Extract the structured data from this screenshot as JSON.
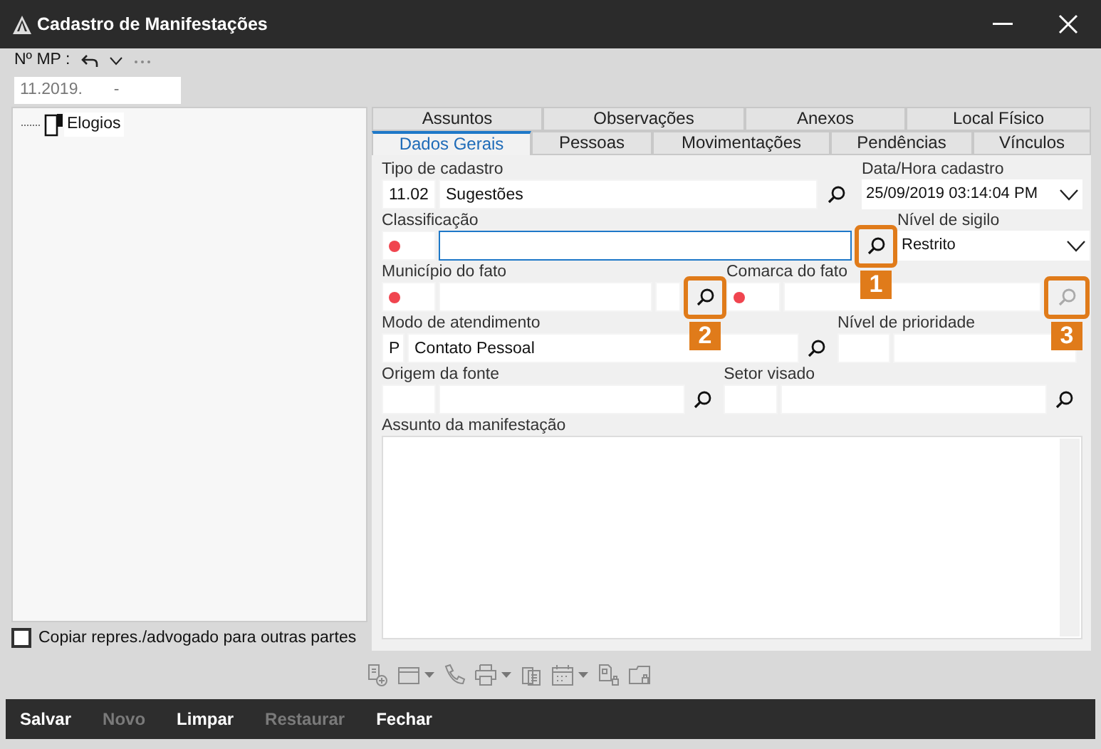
{
  "window": {
    "title": "Cadastro de Manifestações"
  },
  "header": {
    "label": "Nº MP :",
    "value_parts": [
      "11.2019.",
      "-"
    ]
  },
  "tree": [
    {
      "label": "Elogios"
    }
  ],
  "tabs": [
    [
      {
        "label": "Assuntos",
        "selected": false
      },
      {
        "label": "Observações",
        "selected": false
      },
      {
        "label": "Anexos",
        "selected": false
      },
      {
        "label": "Local Físico",
        "selected": false
      }
    ],
    [
      {
        "label": "Dados Gerais",
        "selected": true
      },
      {
        "label": "Pessoas",
        "selected": false
      },
      {
        "label": "Movimentações",
        "selected": false
      },
      {
        "label": "Pendências",
        "selected": false
      },
      {
        "label": "Vínculos",
        "selected": false
      }
    ]
  ],
  "form": [
    {
      "label": "Tipo de cadastro",
      "parts": [
        {
          "kind": "text",
          "value": "11.02"
        },
        {
          "kind": "text",
          "value": "Sugestões"
        },
        {
          "kind": "search",
          "disabled": false
        }
      ]
    },
    {
      "label": "Data/Hora cadastro",
      "parts": [
        {
          "kind": "select",
          "value": "25/09/2019 03:14:04 PM"
        }
      ]
    },
    {
      "label": "Classificação",
      "parts": [
        {
          "kind": "required"
        },
        {
          "kind": "text",
          "focused": true
        },
        {
          "kind": "search",
          "disabled": false,
          "callout": "1"
        }
      ]
    },
    {
      "label": "Nível de sigilo",
      "parts": [
        {
          "kind": "select",
          "value": "Restrito"
        }
      ]
    },
    {
      "label": "Município do fato",
      "parts": [
        {
          "kind": "required"
        },
        {
          "kind": "text"
        },
        {
          "kind": "text"
        },
        {
          "kind": "search",
          "disabled": false,
          "callout": "2"
        }
      ]
    },
    {
      "label": "Comarca do fato",
      "parts": [
        {
          "kind": "required"
        },
        {
          "kind": "text"
        },
        {
          "kind": "search",
          "disabled": true,
          "callout": "3"
        }
      ]
    },
    {
      "label": "Modo de atendimento",
      "parts": [
        {
          "kind": "text",
          "value": "P"
        },
        {
          "kind": "text",
          "value": "Contato Pessoal"
        },
        {
          "kind": "search",
          "disabled": false
        }
      ]
    },
    {
      "label": "Nível de prioridade",
      "parts": [
        {
          "kind": "text"
        },
        {
          "kind": "text"
        }
      ]
    },
    {
      "label": "Origem da fonte",
      "parts": [
        {
          "kind": "text"
        },
        {
          "kind": "text"
        },
        {
          "kind": "search",
          "disabled": false
        }
      ]
    },
    {
      "label": "Setor visado",
      "parts": [
        {
          "kind": "text"
        },
        {
          "kind": "text"
        },
        {
          "kind": "search",
          "disabled": false
        }
      ]
    },
    {
      "label": "Assunto da manifestação",
      "parts": [
        {
          "kind": "textarea"
        }
      ]
    }
  ],
  "copy_checkbox": {
    "label": "Copiar repres./advogado para outras partes",
    "checked": false
  },
  "buttons": [
    {
      "label": "Salvar",
      "disabled": false
    },
    {
      "label": "Novo",
      "disabled": true
    },
    {
      "label": "Limpar",
      "disabled": false
    },
    {
      "label": "Restaurar",
      "disabled": true
    },
    {
      "label": "Fechar",
      "disabled": false
    }
  ]
}
